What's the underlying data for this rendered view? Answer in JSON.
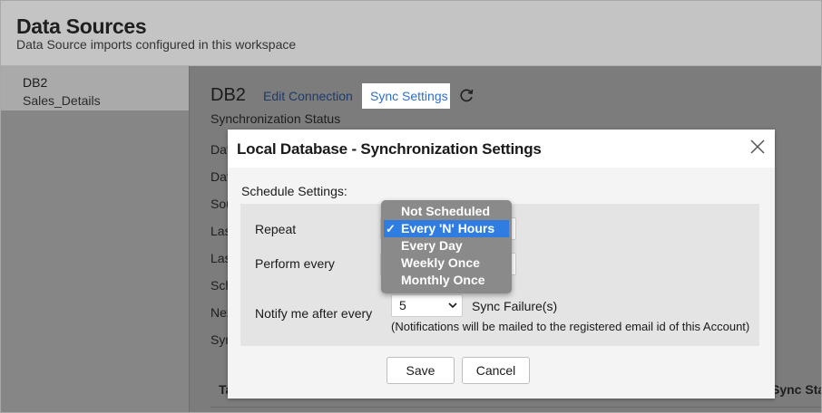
{
  "header": {
    "title": "Data Sources",
    "subtitle": "Data Source imports configured in this workspace"
  },
  "sidebar": {
    "items": [
      {
        "db": "DB2",
        "table": "Sales_Details"
      }
    ]
  },
  "main": {
    "db_name": "DB2",
    "edit_connection": "Edit Connection",
    "sync_settings": "Sync Settings",
    "sync_status_label": "Synchronization Status",
    "background_rows": [
      "Dat",
      "Dat",
      "Sou",
      "Las",
      "Las",
      "Sch",
      "Nex",
      "Syn"
    ],
    "table_header_left": "Ta",
    "table_header_right": "Sync Sta"
  },
  "modal": {
    "title": "Local Database - Synchronization Settings",
    "schedule_label": "Schedule Settings:",
    "repeat_label": "Repeat",
    "perform_label": "Perform every",
    "notify_label": "Notify me after every",
    "notify_value": "5",
    "notify_suffix": "Sync Failure(s)",
    "notify_note": "(Notifications will be mailed to the registered email id of this Account)",
    "save": "Save",
    "cancel": "Cancel"
  },
  "repeat_menu": {
    "options": [
      "Not Scheduled",
      "Every 'N' Hours",
      "Every Day",
      "Weekly Once",
      "Monthly Once"
    ],
    "selected": "Every 'N' Hours",
    "check": "✓"
  },
  "colors": {
    "link": "#2a6fd1",
    "menu_selected": "#2f7de1"
  }
}
